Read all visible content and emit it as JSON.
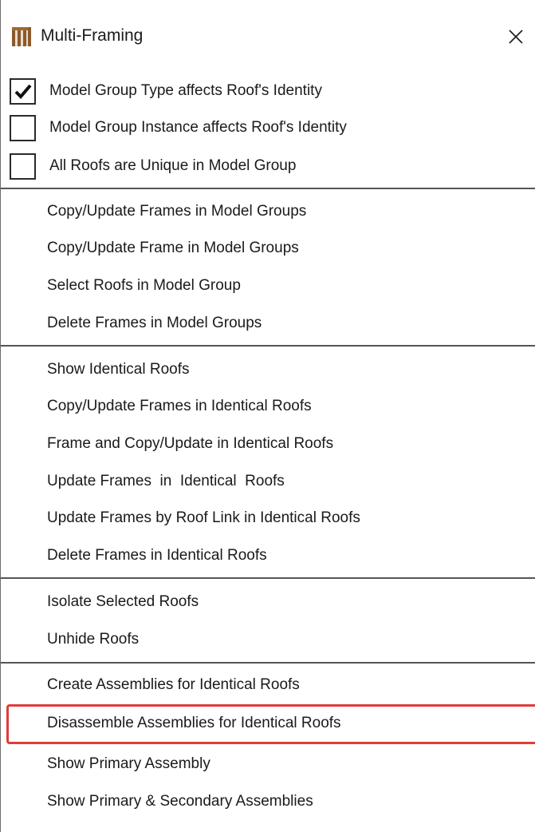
{
  "window": {
    "title": "Multi-Framing",
    "icon": "roof-framing-icon",
    "close_label": "✕"
  },
  "checkboxes": [
    {
      "label": "Model Group Type affects Roof's Identity",
      "checked": true
    },
    {
      "label": "Model Group Instance affects Roof's Identity",
      "checked": false
    },
    {
      "label": "All Roofs are Unique in Model Group",
      "checked": false
    }
  ],
  "model_groups": [
    "Copy/Update Frames in Model Groups",
    "Copy/Update Frame in Model Groups",
    "Select Roofs in Model Group",
    "Delete Frames in Model Groups"
  ],
  "identical_roofs": [
    "Show Identical Roofs",
    "Copy/Update Frames in Identical Roofs",
    "Frame and Copy/Update in Identical Roofs",
    "Update Frames  in  Identical  Roofs",
    "Update Frames by Roof Link in Identical Roofs",
    "Delete Frames in Identical Roofs"
  ],
  "visibility": [
    "Isolate Selected Roofs",
    "Unhide Roofs"
  ],
  "assemblies": [
    "Create Assemblies for Identical Roofs",
    "Disassemble Assemblies for Identical Roofs",
    "Show Primary Assembly",
    "Show Primary & Secondary Assemblies"
  ],
  "highlighted_item": "Disassemble Assemblies for Identical Roofs",
  "colors": {
    "highlight_border": "#e03c3c",
    "separator": "#555555"
  }
}
